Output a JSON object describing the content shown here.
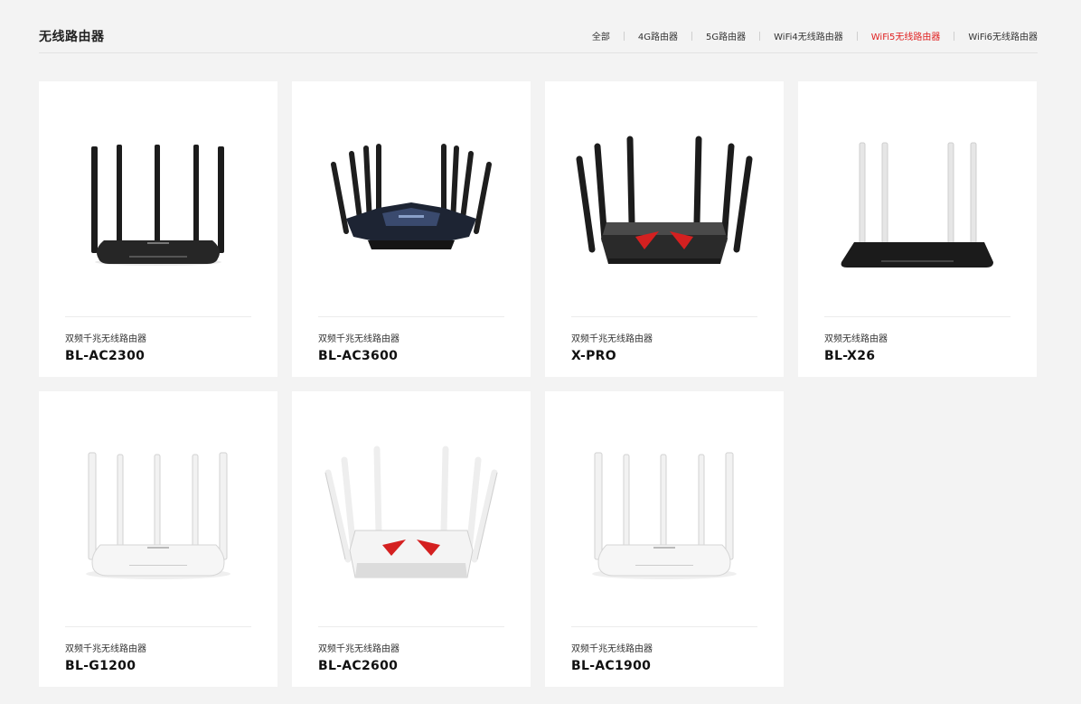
{
  "section": {
    "title": "无线路由器"
  },
  "tabs": [
    {
      "label": "全部",
      "active": false
    },
    {
      "label": "4G路由器",
      "active": false
    },
    {
      "label": "5G路由器",
      "active": false
    },
    {
      "label": "WiFi4无线路由器",
      "active": false
    },
    {
      "label": "WiFi5无线路由器",
      "active": true
    },
    {
      "label": "WiFi6无线路由器",
      "active": false
    }
  ],
  "products": [
    {
      "subtitle": "双频千兆无线路由器",
      "model": "BL-AC2300",
      "image": "black-router-5-antenna"
    },
    {
      "subtitle": "双频千兆无线路由器",
      "model": "BL-AC3600",
      "image": "black-gaming-router-8-antenna"
    },
    {
      "subtitle": "双频千兆无线路由器",
      "model": "X-PRO",
      "image": "black-red-router-6-antenna"
    },
    {
      "subtitle": "双频无线路由器",
      "model": "BL-X26",
      "image": "black-flat-router-4-white-antenna"
    },
    {
      "subtitle": "双频千兆无线路由器",
      "model": "BL-G1200",
      "image": "white-router-5-antenna"
    },
    {
      "subtitle": "双频千兆无线路由器",
      "model": "BL-AC2600",
      "image": "white-red-router-6-antenna"
    },
    {
      "subtitle": "双频千兆无线路由器",
      "model": "BL-AC1900",
      "image": "white-router-5-antenna"
    }
  ],
  "colors": {
    "accent": "#e02020",
    "background": "#f3f3f3",
    "card": "#ffffff"
  }
}
